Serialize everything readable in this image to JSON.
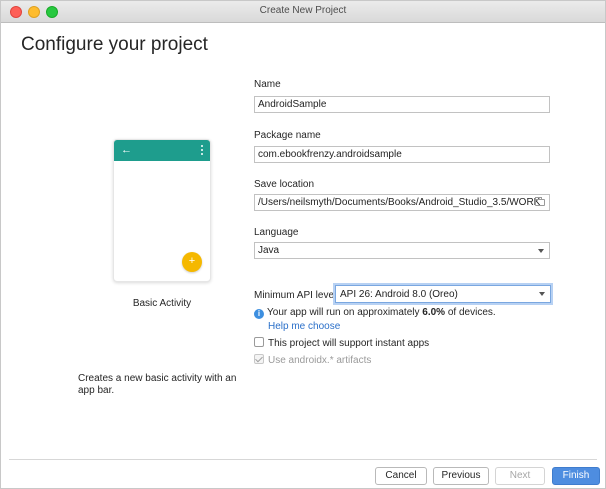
{
  "window": {
    "title": "Create New Project"
  },
  "header": {
    "title": "Configure your project"
  },
  "template": {
    "name": "Basic Activity",
    "description": "Creates a new basic activity with an app bar.",
    "preview_accent": "#1e9d8d",
    "fab_color": "#f5b800",
    "back_glyph": "←",
    "fab_glyph": "+"
  },
  "form": {
    "name_label": "Name",
    "name_value": "AndroidSample",
    "package_label": "Package name",
    "package_value": "com.ebookfrenzy.androidsample",
    "save_label": "Save location",
    "save_value": "/Users/neilsmyth/Documents/Books/Android_Studio_3.5/WORK",
    "language_label": "Language",
    "language_value": "Java",
    "api_label": "Minimum API level",
    "api_value": "API 26: Android 8.0 (Oreo)",
    "info_prefix": "Your app will run on approximately ",
    "info_percent": "6.0%",
    "info_suffix": " of devices.",
    "info_glyph": "i",
    "help_link": "Help me choose",
    "instant_apps_label": "This project will support instant apps",
    "androidx_label": "Use androidx.* artifacts"
  },
  "footer": {
    "cancel": "Cancel",
    "previous": "Previous",
    "next": "Next",
    "finish": "Finish"
  }
}
